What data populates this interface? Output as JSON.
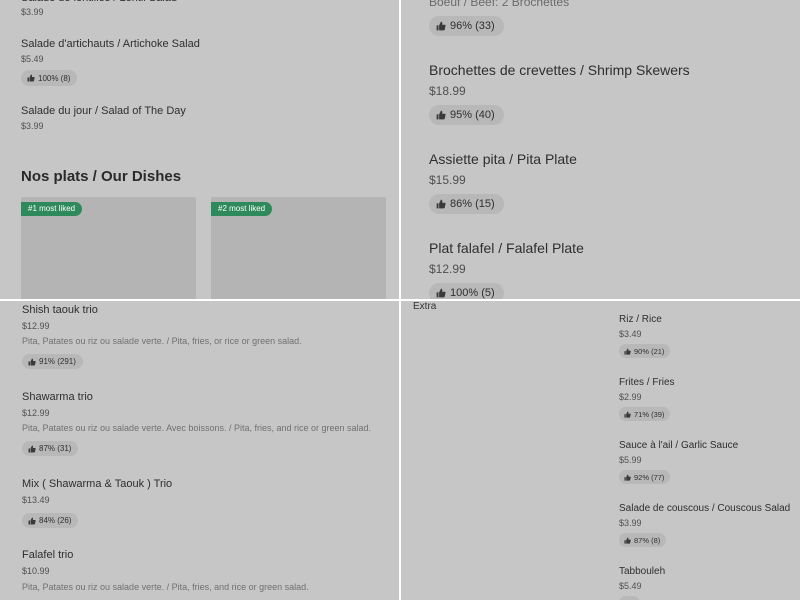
{
  "top_left": {
    "partial_price": "$3.99",
    "items": [
      {
        "name": "Salade d'artichauts / Artichoke Salad",
        "price": "$5.49",
        "rating": "100% (8)"
      },
      {
        "name": "Salade du jour / Salad of The Day",
        "price": "$3.99"
      }
    ],
    "section_title": "Nos plats / Our Dishes",
    "cards": [
      {
        "badge": "#1 most liked"
      },
      {
        "badge": "#2 most liked"
      }
    ]
  },
  "top_right": {
    "partial_desc": "Boeuf / Beef: 2 Brochettes",
    "partial_rating": "96% (33)",
    "items": [
      {
        "name": "Brochettes de crevettes / Shrimp Skewers",
        "price": "$18.99",
        "rating": "95% (40)"
      },
      {
        "name": "Assiette pita / Pita Plate",
        "price": "$15.99",
        "rating": "86% (15)"
      },
      {
        "name": "Plat falafel / Falafel Plate",
        "price": "$12.99",
        "rating": "100% (5)"
      }
    ]
  },
  "bottom_left": {
    "items": [
      {
        "name": "Shish taouk trio",
        "price": "$12.99",
        "desc": "Pita, Patates ou riz ou salade verte. / Pita, fries, or rice or green salad.",
        "rating": "91% (291)"
      },
      {
        "name": "Shawarma trio",
        "price": "$12.99",
        "desc": "Pita, Patates ou riz ou salade verte. Avec boissons. / Pita, fries, and rice or green salad.",
        "rating": "87% (31)"
      },
      {
        "name": "Mix ( Shawarma & Taouk ) Trio",
        "price": "$13.49",
        "rating": "84% (26)"
      },
      {
        "name": "Falafel trio",
        "price": "$10.99",
        "desc": "Pita, Patates ou riz ou salade verte. / Pita, fries, and rice or green salad."
      }
    ]
  },
  "bottom_right": {
    "section_label": "Extra",
    "items": [
      {
        "name": "Riz / Rice",
        "price": "$3.49",
        "rating": "90% (21)"
      },
      {
        "name": "Frites / Fries",
        "price": "$2.99",
        "rating": "71% (39)"
      },
      {
        "name": "Sauce à l'ail / Garlic Sauce",
        "price": "$5.99",
        "rating": "92% (77)"
      },
      {
        "name": "Salade de couscous / Couscous Salad",
        "price": "$3.99",
        "rating": "87% (8)"
      },
      {
        "name": "Tabbouleh",
        "price": "$5.49"
      }
    ]
  },
  "icons": {
    "rating": "thumbs-up-icon"
  },
  "colors": {
    "badge_bg": "#2e8a5a",
    "pill_bg": "#b8b8b8",
    "overlay_bg": "#c6c6c6"
  }
}
